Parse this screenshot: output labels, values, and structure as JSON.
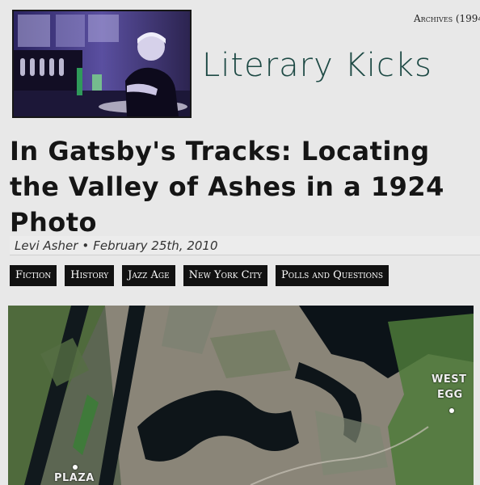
{
  "nav": {
    "archives_label": "Archives (1994"
  },
  "site": {
    "title": "Literary Kicks"
  },
  "post": {
    "title": "In Gatsby's Tracks: Locating the Valley of Ashes in a 1924 Photo",
    "author": "Levi Asher",
    "separator": "•",
    "date": "February 25th, 2010"
  },
  "tags": [
    {
      "label": "Fiction"
    },
    {
      "label": "History"
    },
    {
      "label": "Jazz Age"
    },
    {
      "label": "New York City"
    },
    {
      "label": "Polls and Questions"
    }
  ],
  "map": {
    "labels": {
      "west": "WEST",
      "egg": "EGG",
      "plaza": "PLAZA"
    }
  },
  "colors": {
    "background": "#e8e8e8",
    "title_accent": "#1e4a45",
    "tag_background": "#111111",
    "logo_tint": "#3a2f7a"
  }
}
